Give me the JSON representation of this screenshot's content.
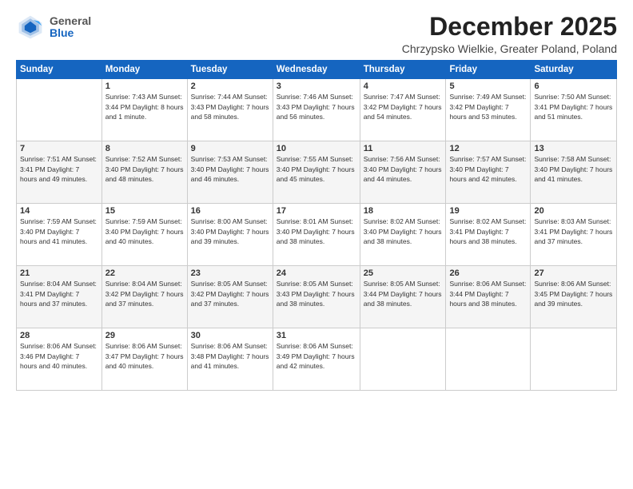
{
  "logo": {
    "general": "General",
    "blue": "Blue"
  },
  "header": {
    "month": "December 2025",
    "location": "Chrzypsko Wielkie, Greater Poland, Poland"
  },
  "weekdays": [
    "Sunday",
    "Monday",
    "Tuesday",
    "Wednesday",
    "Thursday",
    "Friday",
    "Saturday"
  ],
  "weeks": [
    [
      {
        "day": "",
        "info": ""
      },
      {
        "day": "1",
        "info": "Sunrise: 7:43 AM\nSunset: 3:44 PM\nDaylight: 8 hours\nand 1 minute."
      },
      {
        "day": "2",
        "info": "Sunrise: 7:44 AM\nSunset: 3:43 PM\nDaylight: 7 hours\nand 58 minutes."
      },
      {
        "day": "3",
        "info": "Sunrise: 7:46 AM\nSunset: 3:43 PM\nDaylight: 7 hours\nand 56 minutes."
      },
      {
        "day": "4",
        "info": "Sunrise: 7:47 AM\nSunset: 3:42 PM\nDaylight: 7 hours\nand 54 minutes."
      },
      {
        "day": "5",
        "info": "Sunrise: 7:49 AM\nSunset: 3:42 PM\nDaylight: 7 hours\nand 53 minutes."
      },
      {
        "day": "6",
        "info": "Sunrise: 7:50 AM\nSunset: 3:41 PM\nDaylight: 7 hours\nand 51 minutes."
      }
    ],
    [
      {
        "day": "7",
        "info": "Sunrise: 7:51 AM\nSunset: 3:41 PM\nDaylight: 7 hours\nand 49 minutes."
      },
      {
        "day": "8",
        "info": "Sunrise: 7:52 AM\nSunset: 3:40 PM\nDaylight: 7 hours\nand 48 minutes."
      },
      {
        "day": "9",
        "info": "Sunrise: 7:53 AM\nSunset: 3:40 PM\nDaylight: 7 hours\nand 46 minutes."
      },
      {
        "day": "10",
        "info": "Sunrise: 7:55 AM\nSunset: 3:40 PM\nDaylight: 7 hours\nand 45 minutes."
      },
      {
        "day": "11",
        "info": "Sunrise: 7:56 AM\nSunset: 3:40 PM\nDaylight: 7 hours\nand 44 minutes."
      },
      {
        "day": "12",
        "info": "Sunrise: 7:57 AM\nSunset: 3:40 PM\nDaylight: 7 hours\nand 42 minutes."
      },
      {
        "day": "13",
        "info": "Sunrise: 7:58 AM\nSunset: 3:40 PM\nDaylight: 7 hours\nand 41 minutes."
      }
    ],
    [
      {
        "day": "14",
        "info": "Sunrise: 7:59 AM\nSunset: 3:40 PM\nDaylight: 7 hours\nand 41 minutes."
      },
      {
        "day": "15",
        "info": "Sunrise: 7:59 AM\nSunset: 3:40 PM\nDaylight: 7 hours\nand 40 minutes."
      },
      {
        "day": "16",
        "info": "Sunrise: 8:00 AM\nSunset: 3:40 PM\nDaylight: 7 hours\nand 39 minutes."
      },
      {
        "day": "17",
        "info": "Sunrise: 8:01 AM\nSunset: 3:40 PM\nDaylight: 7 hours\nand 38 minutes."
      },
      {
        "day": "18",
        "info": "Sunrise: 8:02 AM\nSunset: 3:40 PM\nDaylight: 7 hours\nand 38 minutes."
      },
      {
        "day": "19",
        "info": "Sunrise: 8:02 AM\nSunset: 3:41 PM\nDaylight: 7 hours\nand 38 minutes."
      },
      {
        "day": "20",
        "info": "Sunrise: 8:03 AM\nSunset: 3:41 PM\nDaylight: 7 hours\nand 37 minutes."
      }
    ],
    [
      {
        "day": "21",
        "info": "Sunrise: 8:04 AM\nSunset: 3:41 PM\nDaylight: 7 hours\nand 37 minutes."
      },
      {
        "day": "22",
        "info": "Sunrise: 8:04 AM\nSunset: 3:42 PM\nDaylight: 7 hours\nand 37 minutes."
      },
      {
        "day": "23",
        "info": "Sunrise: 8:05 AM\nSunset: 3:42 PM\nDaylight: 7 hours\nand 37 minutes."
      },
      {
        "day": "24",
        "info": "Sunrise: 8:05 AM\nSunset: 3:43 PM\nDaylight: 7 hours\nand 38 minutes."
      },
      {
        "day": "25",
        "info": "Sunrise: 8:05 AM\nSunset: 3:44 PM\nDaylight: 7 hours\nand 38 minutes."
      },
      {
        "day": "26",
        "info": "Sunrise: 8:06 AM\nSunset: 3:44 PM\nDaylight: 7 hours\nand 38 minutes."
      },
      {
        "day": "27",
        "info": "Sunrise: 8:06 AM\nSunset: 3:45 PM\nDaylight: 7 hours\nand 39 minutes."
      }
    ],
    [
      {
        "day": "28",
        "info": "Sunrise: 8:06 AM\nSunset: 3:46 PM\nDaylight: 7 hours\nand 40 minutes."
      },
      {
        "day": "29",
        "info": "Sunrise: 8:06 AM\nSunset: 3:47 PM\nDaylight: 7 hours\nand 40 minutes."
      },
      {
        "day": "30",
        "info": "Sunrise: 8:06 AM\nSunset: 3:48 PM\nDaylight: 7 hours\nand 41 minutes."
      },
      {
        "day": "31",
        "info": "Sunrise: 8:06 AM\nSunset: 3:49 PM\nDaylight: 7 hours\nand 42 minutes."
      },
      {
        "day": "",
        "info": ""
      },
      {
        "day": "",
        "info": ""
      },
      {
        "day": "",
        "info": ""
      }
    ]
  ]
}
